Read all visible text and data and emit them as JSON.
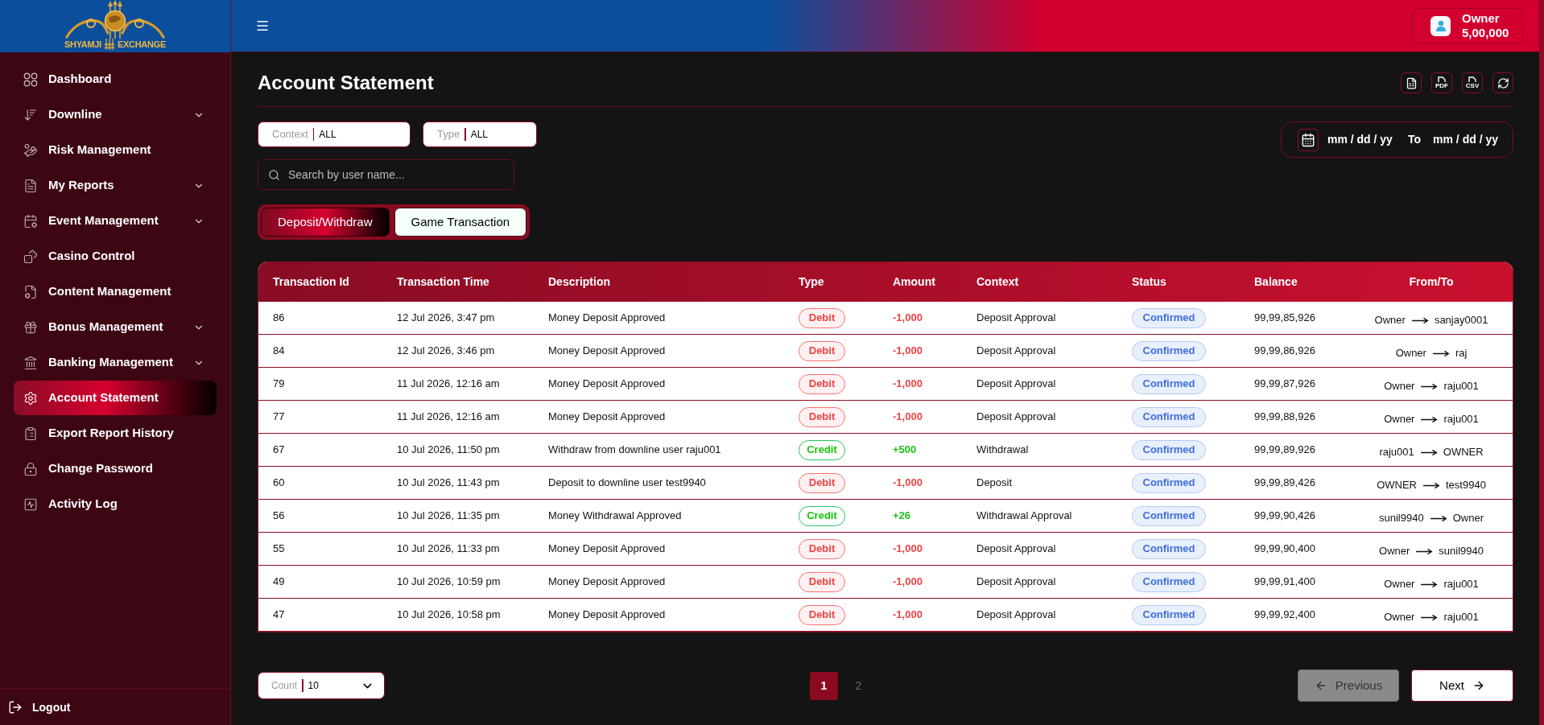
{
  "logo": {
    "left_word": "SHYAMJI",
    "right_word": "EXCHANGE"
  },
  "sidebar": {
    "items": [
      {
        "label": "Dashboard",
        "expandable": false,
        "selected": false
      },
      {
        "label": "Downline",
        "expandable": true,
        "selected": false
      },
      {
        "label": "Risk Management",
        "expandable": false,
        "selected": false
      },
      {
        "label": "My Reports",
        "expandable": true,
        "selected": false
      },
      {
        "label": "Event Management",
        "expandable": true,
        "selected": false
      },
      {
        "label": "Casino Control",
        "expandable": false,
        "selected": false
      },
      {
        "label": "Content Management",
        "expandable": false,
        "selected": false
      },
      {
        "label": "Bonus Management",
        "expandable": true,
        "selected": false
      },
      {
        "label": "Banking Management",
        "expandable": true,
        "selected": false
      },
      {
        "label": "Account Statement",
        "expandable": false,
        "selected": true
      },
      {
        "label": "Export Report History",
        "expandable": false,
        "selected": false
      },
      {
        "label": "Change Password",
        "expandable": false,
        "selected": false
      },
      {
        "label": "Activity Log",
        "expandable": false,
        "selected": false
      }
    ],
    "logout": {
      "label": "Logout"
    }
  },
  "header": {
    "user": {
      "name": "Owner",
      "balance": "5,00,000"
    }
  },
  "page": {
    "title": "Account Statement",
    "toolbar": [
      {
        "kind": "excel"
      },
      {
        "kind": "pdf",
        "label": "PDF"
      },
      {
        "kind": "csv",
        "label": "CSV"
      },
      {
        "kind": "refresh"
      }
    ],
    "filters": [
      {
        "label": "Context",
        "value": "ALL"
      },
      {
        "label": "Type",
        "value": "ALL"
      }
    ],
    "date_range": {
      "from_placeholder": "mm / dd / yy",
      "separator": "To",
      "to_placeholder": "mm / dd / yy"
    },
    "search": {
      "placeholder": "Search by user name..."
    },
    "tabs": [
      {
        "label": "Deposit/Withdraw",
        "selected": true
      },
      {
        "label": "Game Transaction",
        "selected": false
      }
    ]
  },
  "table": {
    "columns": [
      "Transaction Id",
      "Transaction Time",
      "Description",
      "Type",
      "Amount",
      "Context",
      "Status",
      "Balance",
      "From/To"
    ],
    "rows": [
      {
        "id": "86",
        "time": "12 Jul 2026, 3:47 pm",
        "description": "Money Deposit Approved",
        "type": "Debit",
        "kind": "debit",
        "amount": "-1,000",
        "context": "Deposit Approval",
        "status": "Confirmed",
        "balance": "99,99,85,926",
        "from": "Owner",
        "to": "sanjay0001"
      },
      {
        "id": "84",
        "time": "12 Jul 2026, 3:46 pm",
        "description": "Money Deposit Approved",
        "type": "Debit",
        "kind": "debit",
        "amount": "-1,000",
        "context": "Deposit Approval",
        "status": "Confirmed",
        "balance": "99,99,86,926",
        "from": "Owner",
        "to": "raj"
      },
      {
        "id": "79",
        "time": "11 Jul 2026, 12:16 am",
        "description": "Money Deposit Approved",
        "type": "Debit",
        "kind": "debit",
        "amount": "-1,000",
        "context": "Deposit Approval",
        "status": "Confirmed",
        "balance": "99,99,87,926",
        "from": "Owner",
        "to": "raju001"
      },
      {
        "id": "77",
        "time": "11 Jul 2026, 12:16 am",
        "description": "Money Deposit Approved",
        "type": "Debit",
        "kind": "debit",
        "amount": "-1,000",
        "context": "Deposit Approval",
        "status": "Confirmed",
        "balance": "99,99,88,926",
        "from": "Owner",
        "to": "raju001"
      },
      {
        "id": "67",
        "time": "10 Jul 2026, 11:50 pm",
        "description": "Withdraw from downline user raju001",
        "type": "Credit",
        "kind": "credit",
        "amount": "+500",
        "context": "Withdrawal",
        "status": "Confirmed",
        "balance": "99,99,89,926",
        "from": "raju001",
        "to": "OWNER"
      },
      {
        "id": "60",
        "time": "10 Jul 2026, 11:43 pm",
        "description": "Deposit to downline user test9940",
        "type": "Debit",
        "kind": "debit",
        "amount": "-1,000",
        "context": "Deposit",
        "status": "Confirmed",
        "balance": "99,99,89,426",
        "from": "OWNER",
        "to": "test9940"
      },
      {
        "id": "56",
        "time": "10 Jul 2026, 11:35 pm",
        "description": "Money Withdrawal Approved",
        "type": "Credit",
        "kind": "credit",
        "amount": "+26",
        "context": "Withdrawal Approval",
        "status": "Confirmed",
        "balance": "99,99,90,426",
        "from": "sunil9940",
        "to": "Owner"
      },
      {
        "id": "55",
        "time": "10 Jul 2026, 11:33 pm",
        "description": "Money Deposit Approved",
        "type": "Debit",
        "kind": "debit",
        "amount": "-1,000",
        "context": "Deposit Approval",
        "status": "Confirmed",
        "balance": "99,99,90,400",
        "from": "Owner",
        "to": "sunil9940"
      },
      {
        "id": "49",
        "time": "10 Jul 2026, 10:59 pm",
        "description": "Money Deposit Approved",
        "type": "Debit",
        "kind": "debit",
        "amount": "-1,000",
        "context": "Deposit Approval",
        "status": "Confirmed",
        "balance": "99,99,91,400",
        "from": "Owner",
        "to": "raju001"
      },
      {
        "id": "47",
        "time": "10 Jul 2026, 10:58 pm",
        "description": "Money Deposit Approved",
        "type": "Debit",
        "kind": "debit",
        "amount": "-1,000",
        "context": "Deposit Approval",
        "status": "Confirmed",
        "balance": "99,99,92,400",
        "from": "Owner",
        "to": "raju001"
      }
    ]
  },
  "pagination": {
    "count": {
      "label": "Count",
      "value": "10"
    },
    "pages": [
      {
        "label": "1",
        "selected": true
      },
      {
        "label": "2",
        "selected": false
      }
    ],
    "previous": {
      "label": "Previous",
      "disabled": true
    },
    "next": {
      "label": "Next",
      "disabled": false
    }
  }
}
